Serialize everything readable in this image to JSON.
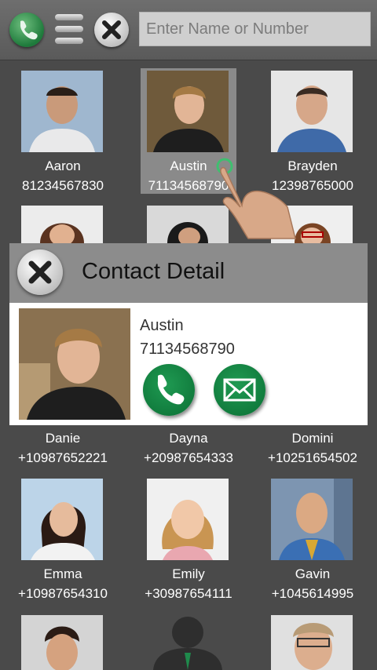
{
  "search": {
    "placeholder": "Enter Name or Number"
  },
  "colors": {
    "accent_green": "#1a8a48",
    "popup_header": "#8c8c8c",
    "background": "#4a4a4a"
  },
  "icons": {
    "call": "phone-icon",
    "menu": "menu-icon",
    "close": "close-icon",
    "message": "envelope-icon"
  },
  "contacts": [
    {
      "name": "Aaron",
      "number": "81234567830"
    },
    {
      "name": "Austin",
      "number": "71134568790",
      "selected": true
    },
    {
      "name": "Brayden",
      "number": "12398765000"
    },
    {
      "name": "Danie",
      "number": "+10987652221"
    },
    {
      "name": "Dayna",
      "number": "+20987654333"
    },
    {
      "name": "Domini",
      "number": "+10251654502"
    },
    {
      "name": "Emma",
      "number": "+10987654310"
    },
    {
      "name": "Emily",
      "number": "+30987654111"
    },
    {
      "name": "Gavin",
      "number": "+1045614995"
    }
  ],
  "detail": {
    "title": "Contact Detail",
    "name": "Austin",
    "number": "71134568790"
  }
}
